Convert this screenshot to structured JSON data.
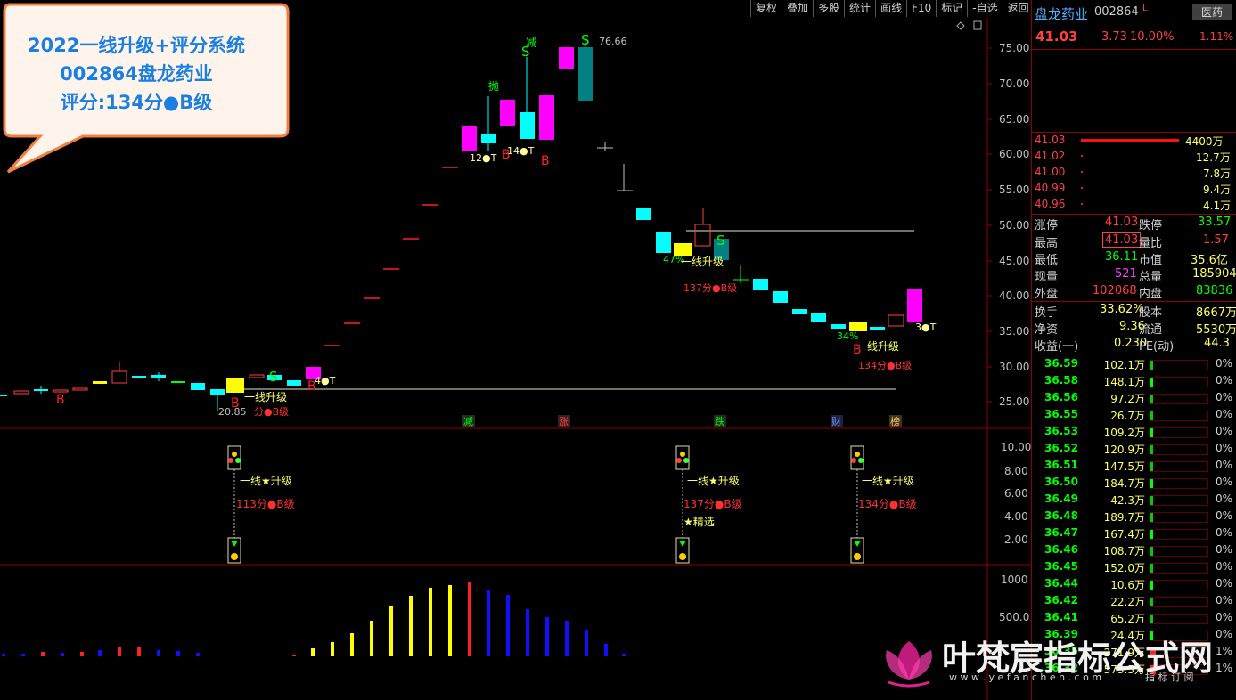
{
  "toolbar": {
    "items": [
      "复权",
      "叠加",
      "多股",
      "统计",
      "画线",
      "F10",
      "标记",
      "-自选",
      "返回"
    ]
  },
  "callout": {
    "line1": "2022一线升级+评分系统",
    "line2": "002864盘龙药业",
    "line3": "评分:134分●B级"
  },
  "main_chart": {
    "price_axis": [
      "75.00",
      "70.00",
      "65.00",
      "60.00",
      "55.00",
      "50.00",
      "45.00",
      "40.00",
      "35.00",
      "30.00",
      "25.00"
    ],
    "high_label": "76.66",
    "bottom_label": "20.85",
    "event_tags": [
      "减",
      "涨",
      "跌",
      "财",
      "榜"
    ],
    "annotations": {
      "a1_upgrade": "一线升级",
      "a1_score": "分●B级",
      "a2_pct": "47%",
      "a2_upgrade": "一线升级",
      "a2_score": "137分●B级",
      "a3_pct": "34%",
      "a3_upgrade": "一线升级",
      "a3_score": "134分●B级",
      "t1": "12●T",
      "t2": "14●T",
      "t3": "4●T",
      "t4": "3●T",
      "sig_pao": "抛",
      "sig_jian": "减",
      "b": "B",
      "s": "S"
    }
  },
  "indicator": {
    "axis": [
      "10.00",
      "8.00",
      "6.00",
      "4.00",
      "2.00"
    ],
    "groups": [
      {
        "upgrade": "一线★升级",
        "score": "113分●B级",
        "extra": ""
      },
      {
        "upgrade": "一线★升级",
        "score": "137分●B级",
        "extra": "★精选"
      },
      {
        "upgrade": "一线★升级",
        "score": "134分●B级",
        "extra": ""
      }
    ]
  },
  "volume": {
    "axis": [
      "1000",
      "500.0"
    ]
  },
  "stock": {
    "name": "盘龙药业",
    "code": "002864",
    "flag": "L",
    "sector": "医药",
    "sector_pct": "1.11%",
    "price": "41.03",
    "change": "3.73",
    "change_pct": "10.00%"
  },
  "order_book": [
    {
      "price": "41.03",
      "vol": "4400万"
    },
    {
      "price": "41.02",
      "vol": "12.7万"
    },
    {
      "price": "41.00",
      "vol": "7.8万"
    },
    {
      "price": "40.99",
      "vol": "9.4万"
    },
    {
      "price": "40.96",
      "vol": "4.1万"
    }
  ],
  "quote_stats": [
    {
      "l1": "涨停",
      "v1": "41.03",
      "l2": "跌停",
      "v2": "33.57"
    },
    {
      "l1": "最高",
      "v1": "41.03",
      "l2": "量比",
      "v2": "1.57"
    },
    {
      "l1": "最低",
      "v1": "36.11",
      "l2": "市值",
      "v2": "35.6亿"
    },
    {
      "l1": "现量",
      "v1": "521",
      "l2": "总量",
      "v2": "185904"
    },
    {
      "l1": "外盘",
      "v1": "102068",
      "l2": "内盘",
      "v2": "83836"
    }
  ],
  "fin_stats": [
    {
      "l1": "换手",
      "v1": "33.62%",
      "l2": "股本",
      "v2": "8667万"
    },
    {
      "l1": "净资",
      "v1": "9.36",
      "l2": "流通",
      "v2": "5530万"
    },
    {
      "l1": "收益(一)",
      "v1": "0.230",
      "l2": "PE(动)",
      "v2": "44.3"
    }
  ],
  "price_dist": [
    {
      "price": "36.59",
      "vol": "102.1万",
      "pct": "0%"
    },
    {
      "price": "36.58",
      "vol": "148.1万",
      "pct": "0%"
    },
    {
      "price": "36.56",
      "vol": "97.2万",
      "pct": "0%"
    },
    {
      "price": "36.55",
      "vol": "26.7万",
      "pct": "0%"
    },
    {
      "price": "36.53",
      "vol": "109.2万",
      "pct": "0%"
    },
    {
      "price": "36.52",
      "vol": "120.9万",
      "pct": "0%"
    },
    {
      "price": "36.51",
      "vol": "147.5万",
      "pct": "0%"
    },
    {
      "price": "36.50",
      "vol": "184.7万",
      "pct": "0%"
    },
    {
      "price": "36.49",
      "vol": "42.3万",
      "pct": "0%"
    },
    {
      "price": "36.48",
      "vol": "189.7万",
      "pct": "0%"
    },
    {
      "price": "36.47",
      "vol": "167.4万",
      "pct": "0%"
    },
    {
      "price": "36.46",
      "vol": "108.7万",
      "pct": "0%"
    },
    {
      "price": "36.45",
      "vol": "152.0万",
      "pct": "0%"
    },
    {
      "price": "36.44",
      "vol": "10.6万",
      "pct": "0%"
    },
    {
      "price": "36.42",
      "vol": "22.2万",
      "pct": "0%"
    },
    {
      "price": "36.41",
      "vol": "65.2万",
      "pct": "0%"
    },
    {
      "price": "36.39",
      "vol": "24.4万",
      "pct": "0%"
    },
    {
      "price": "36.35",
      "vol": "271.9万",
      "pct": "1%"
    },
    {
      "price": "36.32",
      "vol": "573.5万",
      "pct": "1%"
    }
  ],
  "watermark": {
    "title": "叶梵宸指标公式网",
    "url": "w w w . y e f a n c h e n . c o m",
    "sub": "指 标 订 阅"
  }
}
